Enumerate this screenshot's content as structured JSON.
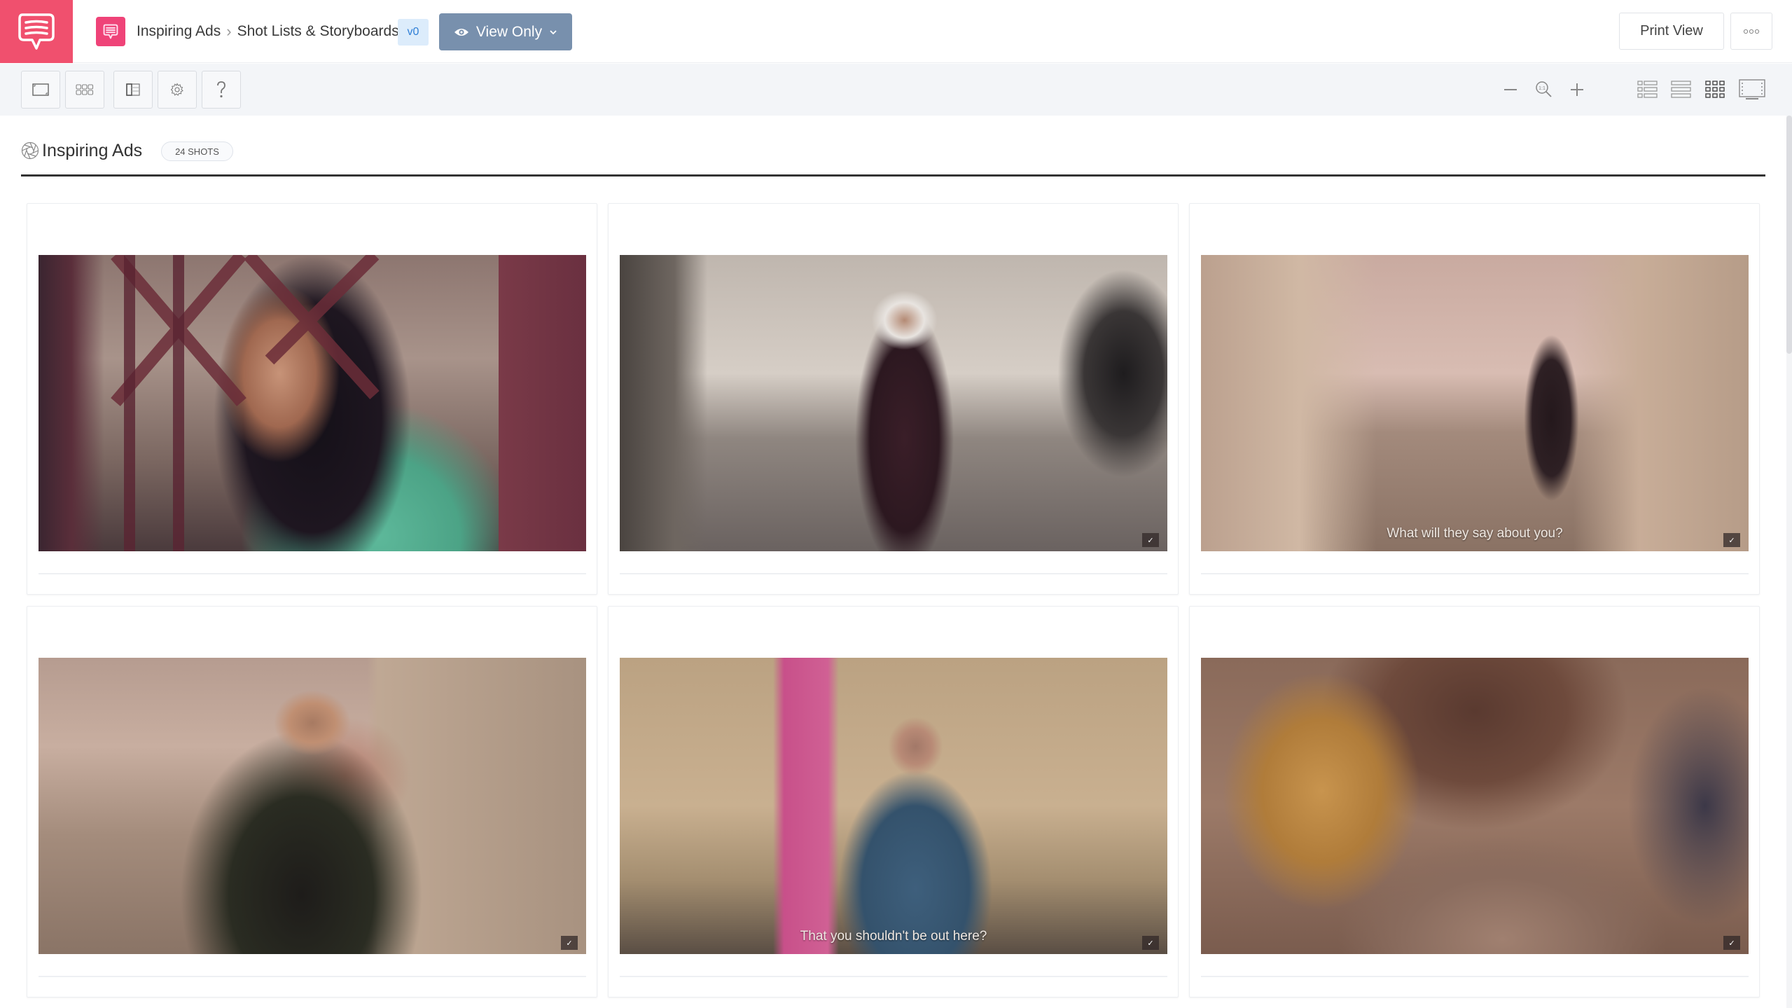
{
  "app": {
    "logo_icon": "speech-bubble-icon",
    "brand_color": "#f0506e"
  },
  "header": {
    "breadcrumb": [
      {
        "label": "Inspiring Ads"
      },
      {
        "label": "Shot Lists & Storyboards"
      }
    ],
    "breadcrumb_separator": ">",
    "version_badge": "v0",
    "view_mode_button": {
      "label": "View Only",
      "icon": "eye-icon",
      "color": "#7890ad"
    },
    "print_button": "Print View",
    "more_button": "ooo"
  },
  "toolbar": {
    "left_buttons": [
      {
        "name": "frame-aspect-button",
        "icon": "aspect-ratio-icon"
      },
      {
        "name": "grid-layout-button",
        "icon": "grid-icon"
      },
      {
        "name": "panel-layout-button",
        "icon": "split-panel-icon"
      },
      {
        "name": "settings-button",
        "icon": "gear-icon"
      },
      {
        "name": "help-button",
        "icon": "question-icon",
        "label": "?"
      }
    ],
    "zoom_controls": [
      {
        "name": "zoom-out-button",
        "icon": "minus-icon"
      },
      {
        "name": "zoom-reset-button",
        "icon": "zoom-1to1-icon",
        "label": "1:1"
      },
      {
        "name": "zoom-in-button",
        "icon": "plus-icon"
      }
    ],
    "view_modes": [
      {
        "name": "view-list-thumb",
        "icon": "list-thumbnail-icon",
        "active": false
      },
      {
        "name": "view-list",
        "icon": "list-icon",
        "active": false
      },
      {
        "name": "view-grid",
        "icon": "grid-icon",
        "active": true
      },
      {
        "name": "view-presentation",
        "icon": "presentation-icon",
        "active": false
      }
    ]
  },
  "section": {
    "icon": "aperture-icon",
    "title": "Inspiring Ads",
    "shot_count": "24 SHOTS"
  },
  "shots": [
    {
      "subtitle": "",
      "has_watermark": false,
      "scene": "woman in black hijab and teal shirt at red gate"
    },
    {
      "subtitle": "",
      "has_watermark": true,
      "scene": "older woman in white hijab in alley"
    },
    {
      "subtitle": "What will they say about you?",
      "has_watermark": true,
      "scene": "woman skateboarding down street between buildings"
    },
    {
      "subtitle": "",
      "has_watermark": true,
      "scene": "woman in patterned hijab in front of building"
    },
    {
      "subtitle": "That you shouldn't be out here?",
      "has_watermark": true,
      "scene": "older man in denim shirt standing by wall"
    },
    {
      "subtitle": "",
      "has_watermark": true,
      "scene": "boxer with glove close-up"
    }
  ]
}
